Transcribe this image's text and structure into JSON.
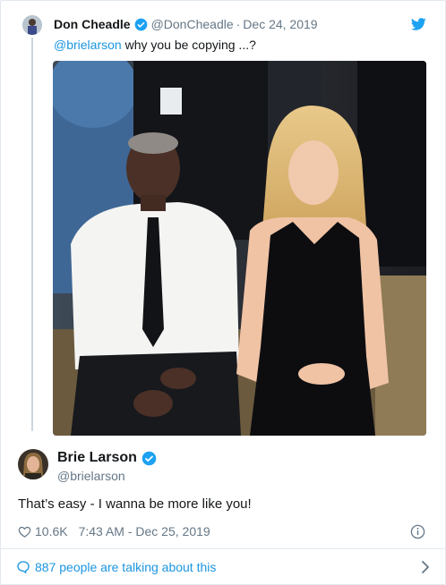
{
  "parent_tweet": {
    "author_name": "Don Cheadle",
    "author_handle": "@DonCheadle",
    "separator": "·",
    "date": "Dec 24, 2019",
    "mention": "@brielarson",
    "text": " why you be copying ...?",
    "verified": true
  },
  "main_tweet": {
    "author_name": "Brie Larson",
    "author_handle": "@brielarson",
    "verified": true,
    "text": "That’s easy - I wanna be more like you!",
    "like_count": "10.6K",
    "timestamp": "7:43 AM - Dec 25, 2019"
  },
  "footer": {
    "talking_text": "887 people are talking about this"
  },
  "colors": {
    "link": "#1b95e0",
    "muted": "#657786",
    "text": "#14171a",
    "verified": "#1da1f2",
    "border": "#e1e8ed"
  },
  "icons": [
    "verified-badge-icon",
    "twitter-bird-icon",
    "heart-icon",
    "info-icon",
    "speech-bubble-icon",
    "chevron-right-icon"
  ]
}
